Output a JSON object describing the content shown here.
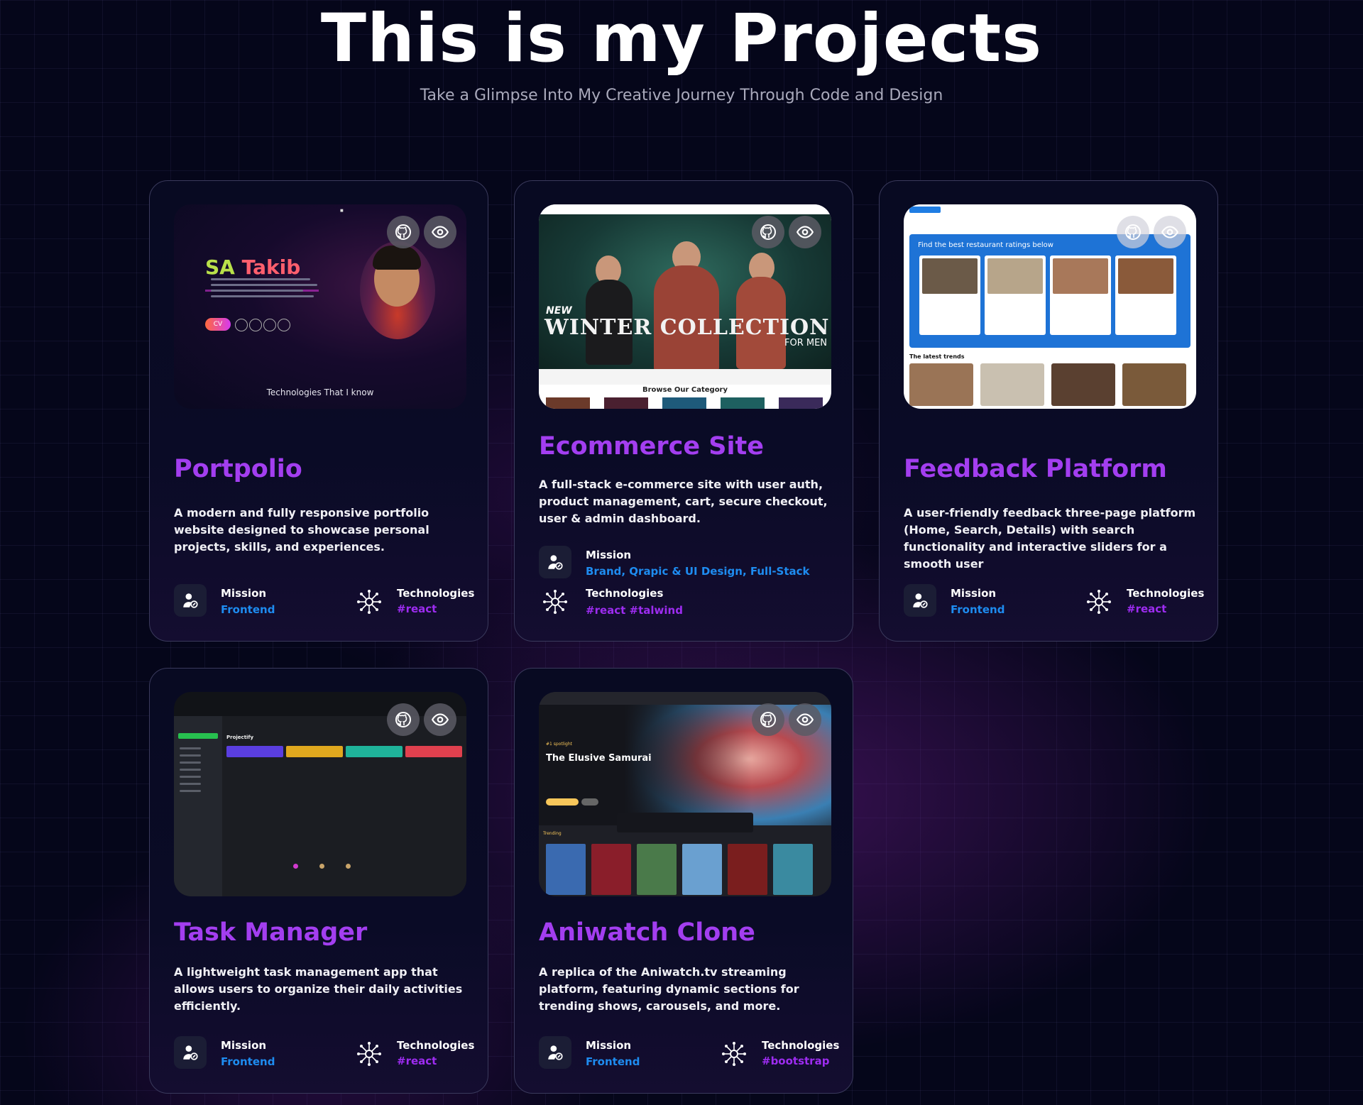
{
  "header": {
    "title": "This is my Projects",
    "subtitle": "Take a Glimpse Into My Creative Journey Through Code and Design"
  },
  "labels": {
    "mission": "Mission",
    "technologies": "Technologies"
  },
  "projects": [
    {
      "title": "Portpolio",
      "description": "A modern and fully responsive portfolio website designed to showcase personal projects, skills, and experiences.",
      "mission": "Frontend",
      "technologies": "#react",
      "preview": {
        "name_first": "SA",
        "name_last": "Takib",
        "cv": "CV",
        "caption": "Technologies That I know"
      }
    },
    {
      "title": "Ecommerce Site",
      "description": "A full-stack e-commerce site with user auth, product management, cart, secure checkout, user & admin dashboard.",
      "mission": "Brand, Qrapic & UI Design, Full-Stack",
      "technologies": "#react #talwind",
      "preview": {
        "new": "NEW",
        "headline": "WINTER COLLECTION",
        "sub": "FOR MEN",
        "browse": "Browse Our Category"
      }
    },
    {
      "title": "Feedback Platform",
      "description": "A user-friendly feedback three-page platform (Home, Search, Details) with search functionality and interactive sliders for a smooth user",
      "mission": "Frontend",
      "technologies": "#react",
      "preview": {
        "banner": "Find the best restaurant ratings below",
        "trends": "The latest trends"
      }
    },
    {
      "title": "Task Manager",
      "description": "A lightweight task management app that allows users to organize their daily activities efficiently.",
      "mission": "Frontend",
      "technologies": "#react",
      "preview": {
        "app": "Projectify"
      }
    },
    {
      "title": "Aniwatch Clone",
      "description": "A replica of the Aniwatch.tv streaming platform, featuring dynamic sections for trending shows, carousels, and more.",
      "mission": "Frontend",
      "technologies": "#bootstrap",
      "preview": {
        "spotlight": "#1 spotlight",
        "show": "The Elusive Samurai",
        "trending": "Trending"
      }
    }
  ],
  "icons": {
    "github": "github-icon",
    "eye": "eye-icon",
    "mission": "user-edit-icon",
    "technologies": "circuit-hub-icon"
  },
  "colors": {
    "title_purple": "#a33ef0",
    "mission_blue": "#1e8cf0",
    "tech_purple": "#9d2cf0",
    "background": "#05061a"
  }
}
